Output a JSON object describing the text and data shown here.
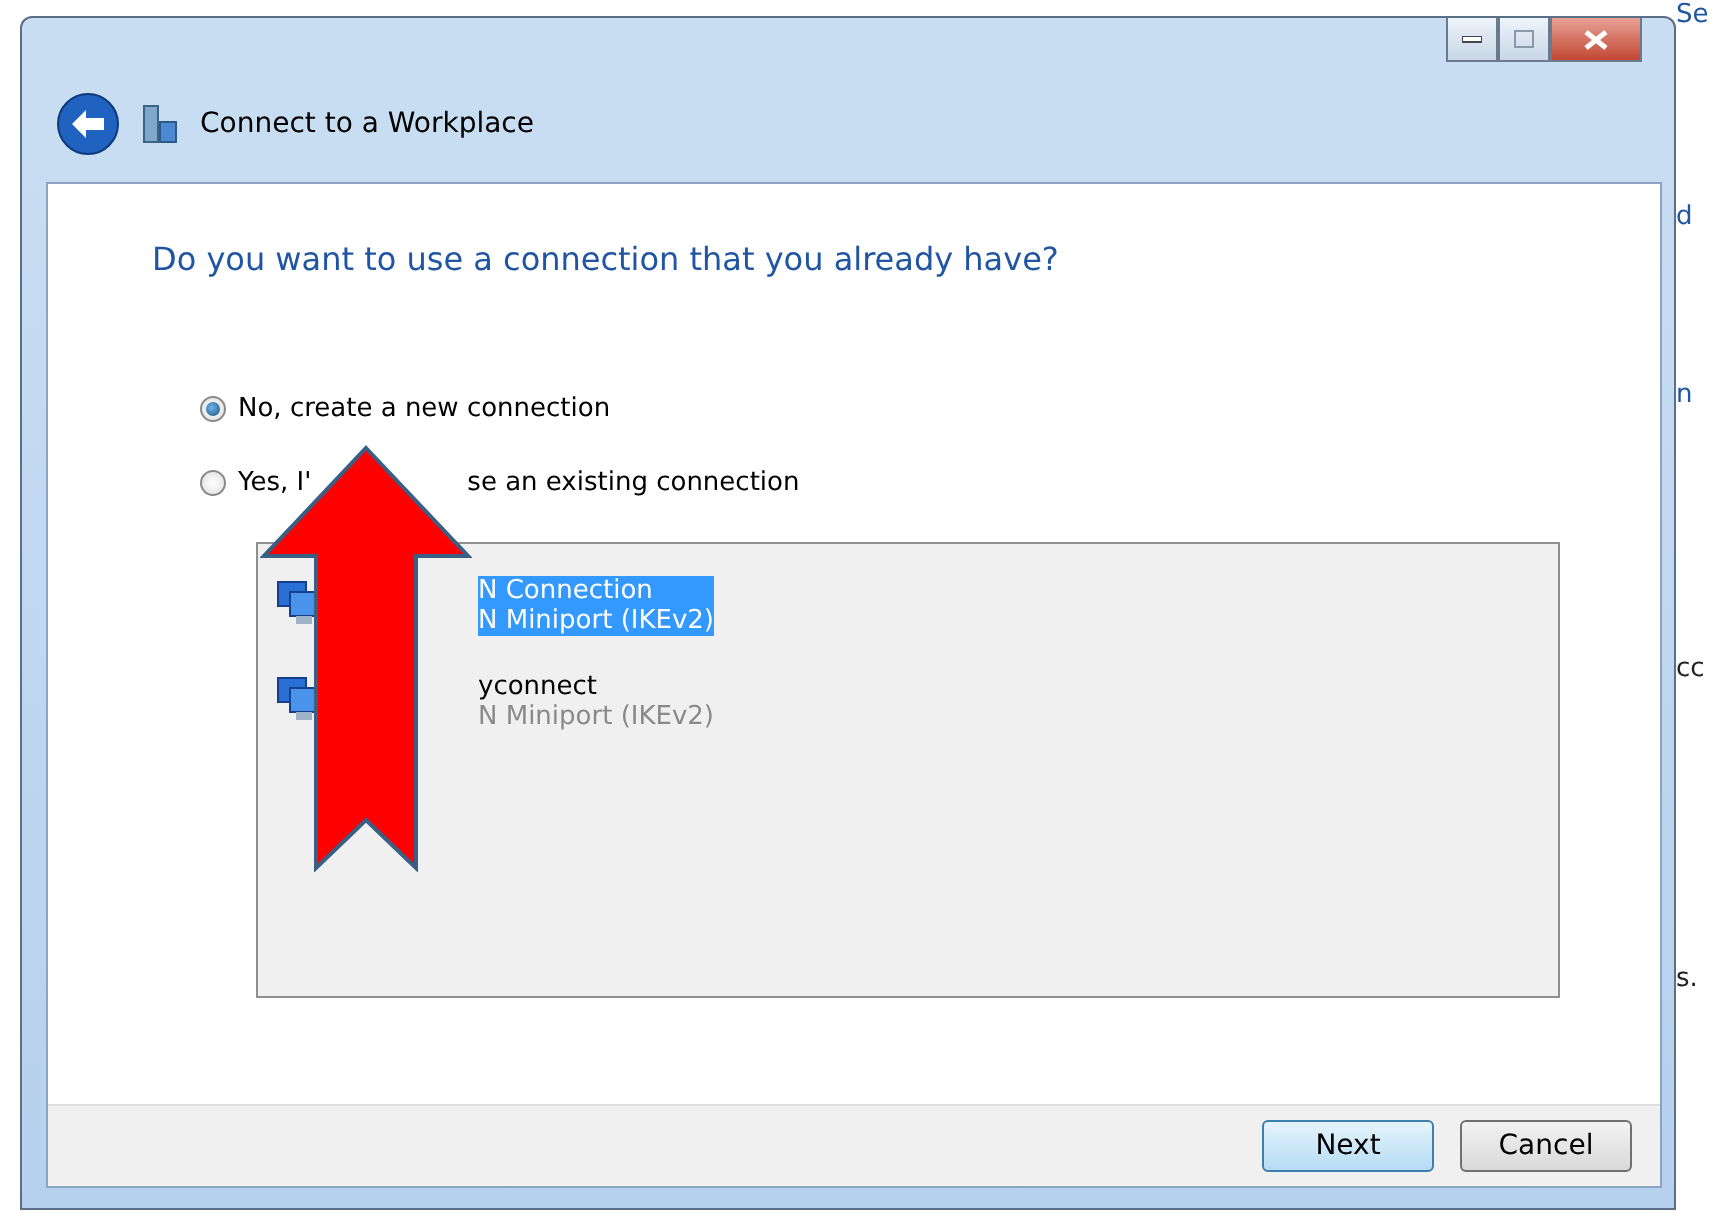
{
  "window": {
    "title": "Connect to a Workplace"
  },
  "heading": "Do you want to use a connection that you already have?",
  "options": [
    {
      "label_parts": [
        "No, create a new connection"
      ],
      "selected": true
    },
    {
      "label_parts": [
        "Yes, I'",
        "se an existing connection"
      ],
      "selected": false
    }
  ],
  "connections": [
    {
      "name": "N Connection",
      "type": "N Miniport (IKEv2)",
      "selected": true
    },
    {
      "name": "yconnect",
      "type": "N Miniport (IKEv2)",
      "selected": false
    }
  ],
  "buttons": [
    {
      "label": "Next",
      "default": true
    },
    {
      "label": "Cancel",
      "default": false
    }
  ],
  "background_fragments": [
    "Se",
    "d",
    "n",
    "cc",
    "s."
  ]
}
